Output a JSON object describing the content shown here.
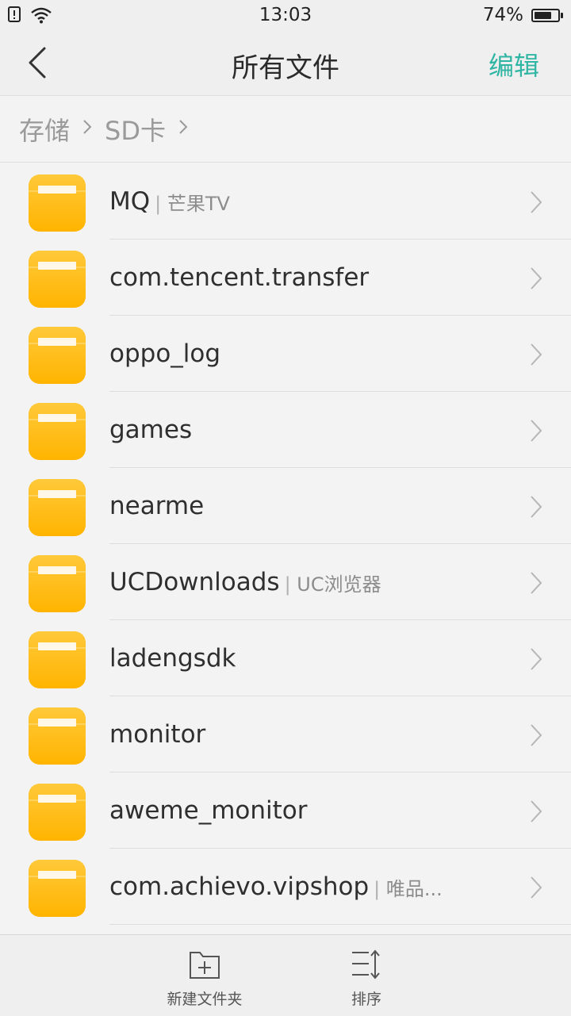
{
  "status_bar": {
    "time": "13:03",
    "battery_percent": "74%",
    "battery_level": 0.74,
    "icons": [
      "sim-alert-icon",
      "wifi-icon",
      "battery-icon"
    ]
  },
  "header": {
    "title": "所有文件",
    "edit_label": "编辑",
    "accent_color": "#2fb5a3"
  },
  "breadcrumb": {
    "items": [
      "存储",
      "SD卡"
    ]
  },
  "files": [
    {
      "name": "MQ",
      "app": "芒果TV"
    },
    {
      "name": "com.tencent.transfer",
      "app": ""
    },
    {
      "name": "oppo_log",
      "app": ""
    },
    {
      "name": "games",
      "app": ""
    },
    {
      "name": "nearme",
      "app": ""
    },
    {
      "name": "UCDownloads",
      "app": "UC浏览器"
    },
    {
      "name": "ladengsdk",
      "app": ""
    },
    {
      "name": "monitor",
      "app": ""
    },
    {
      "name": "aweme_monitor",
      "app": ""
    },
    {
      "name": "com.achievo.vipshop",
      "app": "唯品..."
    }
  ],
  "bottom_bar": {
    "new_folder_label": "新建文件夹",
    "sort_label": "排序"
  },
  "folder_color": "#ffb400"
}
